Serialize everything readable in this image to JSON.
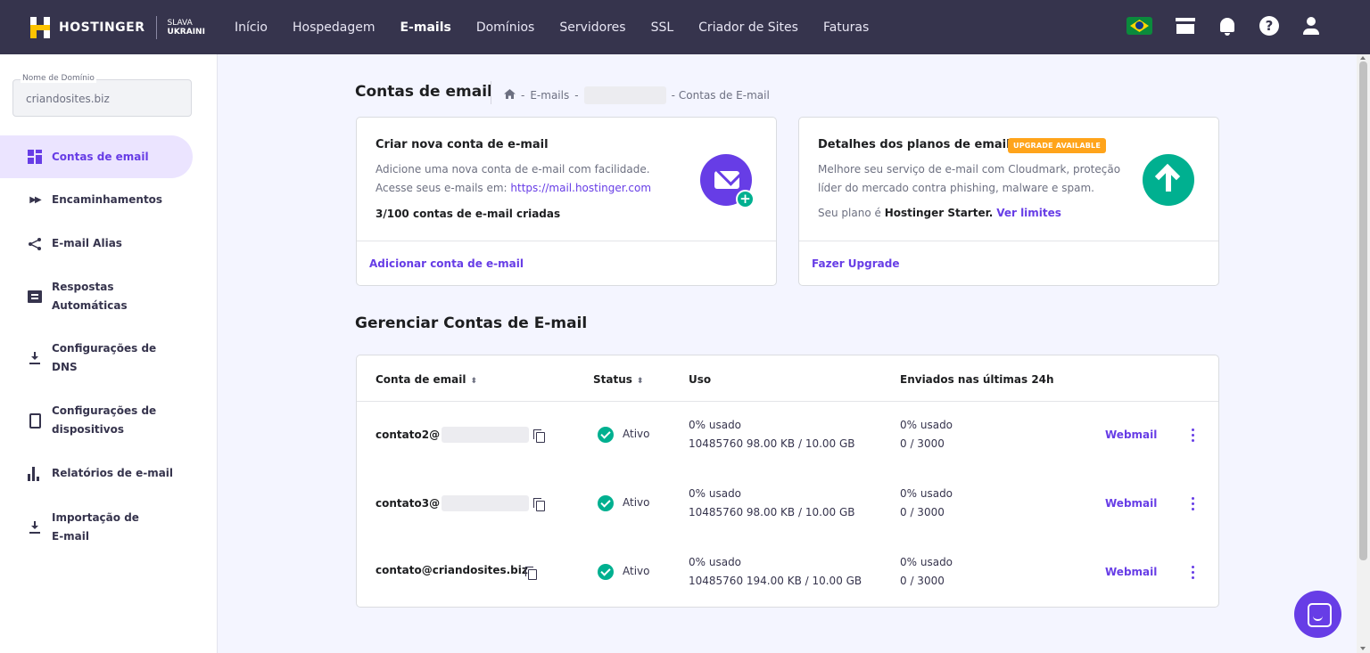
{
  "brand": {
    "name": "HOSTINGER",
    "slava_line1": "SLAVA",
    "slava_line2": "UKRAINI"
  },
  "nav": {
    "items": [
      "Início",
      "Hospedagem",
      "E-mails",
      "Domínios",
      "Servidores",
      "SSL",
      "Criador de Sites",
      "Faturas"
    ],
    "active": "E-mails"
  },
  "top_icons": [
    "brazil-flag-icon",
    "store-icon",
    "bell-icon",
    "help-icon",
    "user-icon"
  ],
  "sidebar": {
    "domain_label": "Nome de Domínio",
    "domain_value": "criandosites.biz",
    "items": [
      {
        "label": "Contas de email",
        "icon": "grid-icon",
        "active": true
      },
      {
        "label": "Encaminhamentos",
        "icon": "fast-forward-icon"
      },
      {
        "label": "E-mail Alias",
        "icon": "share-icon"
      },
      {
        "label": "Respostas Automáticas",
        "icon": "chat-icon"
      },
      {
        "label": "Configurações de DNS",
        "icon": "download-icon"
      },
      {
        "label": "Configurações de dispositivos",
        "icon": "device-icon"
      },
      {
        "label": "Relatórios de e-mail",
        "icon": "bar-chart-icon"
      },
      {
        "label": "Importação de E-mail",
        "icon": "download-icon"
      }
    ]
  },
  "header": {
    "title": "Contas de email",
    "breadcrumb": {
      "sep": "-",
      "emails": "E-mails",
      "current": "Contas de E-mail"
    }
  },
  "create_card": {
    "title": "Criar nova conta de e-mail",
    "line1": "Adicione uma nova conta de e-mail com facilidade.",
    "line2_prefix": "Acesse seus e-mails em: ",
    "line2_link": "https://mail.hostinger.com",
    "count": "3/100 contas de e-mail criadas",
    "action": "Adicionar conta de e-mail"
  },
  "plan_card": {
    "title": "Detalhes dos planos de email",
    "badge": "UPGRADE AVAILABLE",
    "line1": "Melhore seu serviço de e-mail com Cloudmark, proteção",
    "line2": "líder do mercado contra phishing, malware e spam.",
    "plan_prefix": "Seu plano é ",
    "plan_name": "Hostinger Starter.",
    "plan_link": "Ver limites",
    "action": "Fazer Upgrade"
  },
  "manage": {
    "title": "Gerenciar Contas de E-mail",
    "columns": {
      "account": "Conta de email",
      "status": "Status",
      "usage": "Uso",
      "sent": "Enviados nas últimas 24h"
    },
    "rows": [
      {
        "account": "contato2@",
        "status": "Ativo",
        "usage_pct": "0% usado",
        "usage_detail": "10485760 98.00 KB / 10.00 GB",
        "sent_pct": "0% usado",
        "sent_detail": "0 / 3000",
        "action": "Webmail"
      },
      {
        "account": "contato3@",
        "status": "Ativo",
        "usage_pct": "0% usado",
        "usage_detail": "10485760 98.00 KB / 10.00 GB",
        "sent_pct": "0% usado",
        "sent_detail": "0 / 3000",
        "action": "Webmail"
      },
      {
        "account": "contato@criandosites.biz",
        "status": "Ativo",
        "usage_pct": "0% usado",
        "usage_detail": "10485760 194.00 KB / 10.00 GB",
        "sent_pct": "0% usado",
        "sent_detail": "0 / 3000",
        "action": "Webmail"
      }
    ]
  },
  "colors": {
    "nav_bg": "#36344d",
    "accent": "#673de6",
    "success": "#00b090",
    "badge": "#ffa41b"
  }
}
